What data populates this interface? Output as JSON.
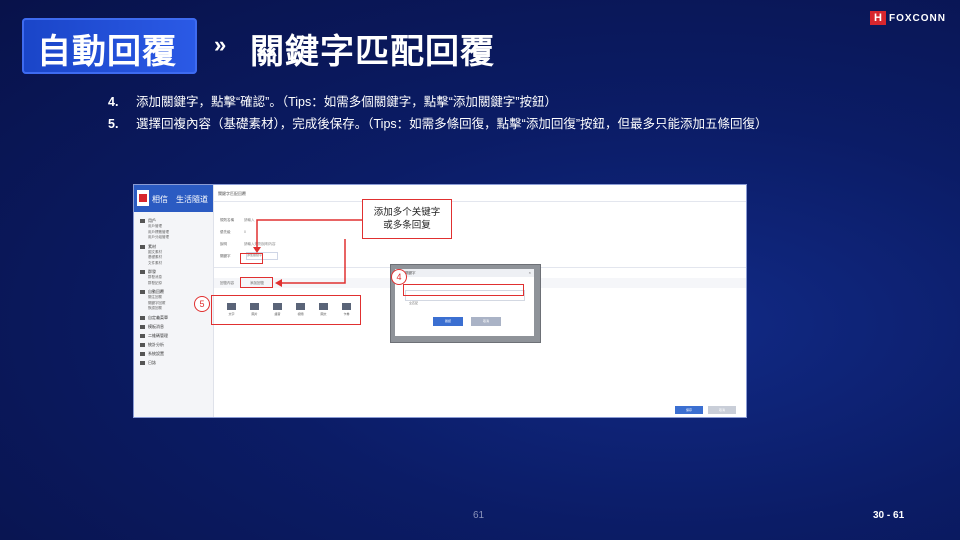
{
  "header": {
    "title": "自動回覆",
    "arrow": "»",
    "subtitle": "關鍵字匹配回覆",
    "logo_mark": "H",
    "logo_text": "FOXCONN"
  },
  "steps": [
    {
      "num": "4.",
      "text": "添加關鍵字，點擊“確認”。（Tips：如需多個關鍵字，點擊“添加關鍵字”按鈕）"
    },
    {
      "num": "5.",
      "text": "選擇回複內容（基礎素材），完成後保存。（Tips：如需多條回復，點擊“添加回復”按鈕，但最多只能添加五條回復）"
    }
  ],
  "screenshot": {
    "brand_name": "相信　生活隨道",
    "topbar": "關鍵字匹配回覆",
    "sidebar": [
      {
        "group": "用戶",
        "items": [
          "用戶管理",
          "用戶標籤管理",
          "用戶分組管理"
        ]
      },
      {
        "group": "素材",
        "items": [
          "圖文素材",
          "基礎素材",
          "文件素材"
        ]
      },
      {
        "group": "群發",
        "items": [
          "群發消息",
          "群發記錄"
        ]
      },
      {
        "group": "自動回覆",
        "items": [
          "關注回覆",
          "關鍵字回覆",
          "默認回覆"
        ]
      },
      {
        "group": "自定義菜單",
        "items": []
      },
      {
        "group": "模板消息",
        "items": []
      },
      {
        "group": "二維碼管理",
        "items": []
      },
      {
        "group": "統計分析",
        "items": []
      },
      {
        "group": "系統設置",
        "items": []
      },
      {
        "group": "日誌",
        "items": []
      }
    ],
    "form_rows": [
      {
        "label": "規則名稱",
        "value": "請輸入"
      },
      {
        "label": "優先級",
        "value": "0"
      },
      {
        "label": "說明",
        "value": "請輸入規則說明內容"
      },
      {
        "label": "關鍵字",
        "value": "添加關鍵字"
      }
    ],
    "reply_label": "回復內容",
    "add_reply": "添加回復",
    "icons": [
      {
        "name": "text-icon",
        "label": "文字"
      },
      {
        "name": "image-icon",
        "label": "圖片"
      },
      {
        "name": "voice-icon",
        "label": "語音"
      },
      {
        "name": "video-icon",
        "label": "視頻"
      },
      {
        "name": "news-icon",
        "label": "圖文"
      },
      {
        "name": "card-icon",
        "label": "卡券"
      }
    ],
    "save_label": "保存",
    "cancel_label": "取消"
  },
  "dialog": {
    "title": "添加關鍵字",
    "close": "×",
    "hint": "全匹配",
    "ok_label": "確認",
    "cancel_label": "取消"
  },
  "annotations": {
    "callout_line1": "添加多个关键字",
    "callout_line2": "或多条回复",
    "marker_4": "4",
    "marker_5": "5"
  },
  "footer": {
    "page_number": "61",
    "page_range": "30 - 61"
  },
  "colors": {
    "background": "#0a1650",
    "title_box": "#2b5ae6",
    "annotation_red": "#e03030",
    "primary_button": "#3b6fd1"
  }
}
